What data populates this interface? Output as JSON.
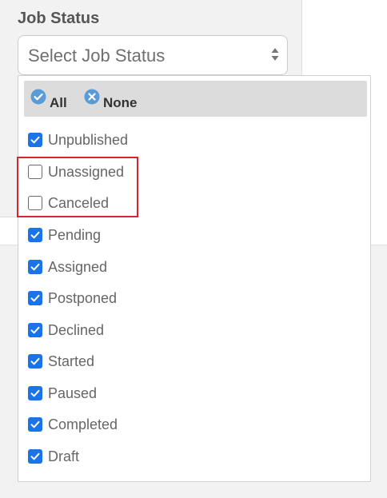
{
  "field": {
    "label": "Job Status",
    "placeholder": "Select Job Status"
  },
  "dropdown": {
    "actions": [
      {
        "label": "All",
        "icon": "check-circle-icon"
      },
      {
        "label": "None",
        "icon": "x-circle-icon"
      }
    ],
    "options": [
      {
        "label": "Unpublished",
        "checked": true
      },
      {
        "label": "Unassigned",
        "checked": false
      },
      {
        "label": "Canceled",
        "checked": false
      },
      {
        "label": "Pending",
        "checked": true
      },
      {
        "label": "Assigned",
        "checked": true
      },
      {
        "label": "Postponed",
        "checked": true
      },
      {
        "label": "Declined",
        "checked": true
      },
      {
        "label": "Started",
        "checked": true
      },
      {
        "label": "Paused",
        "checked": true
      },
      {
        "label": "Completed",
        "checked": true
      },
      {
        "label": "Draft",
        "checked": true
      }
    ]
  },
  "colors": {
    "checkbox_checked": "#1a73e8",
    "highlight": "#d9232d",
    "action_icon": "#5b9bd5"
  }
}
